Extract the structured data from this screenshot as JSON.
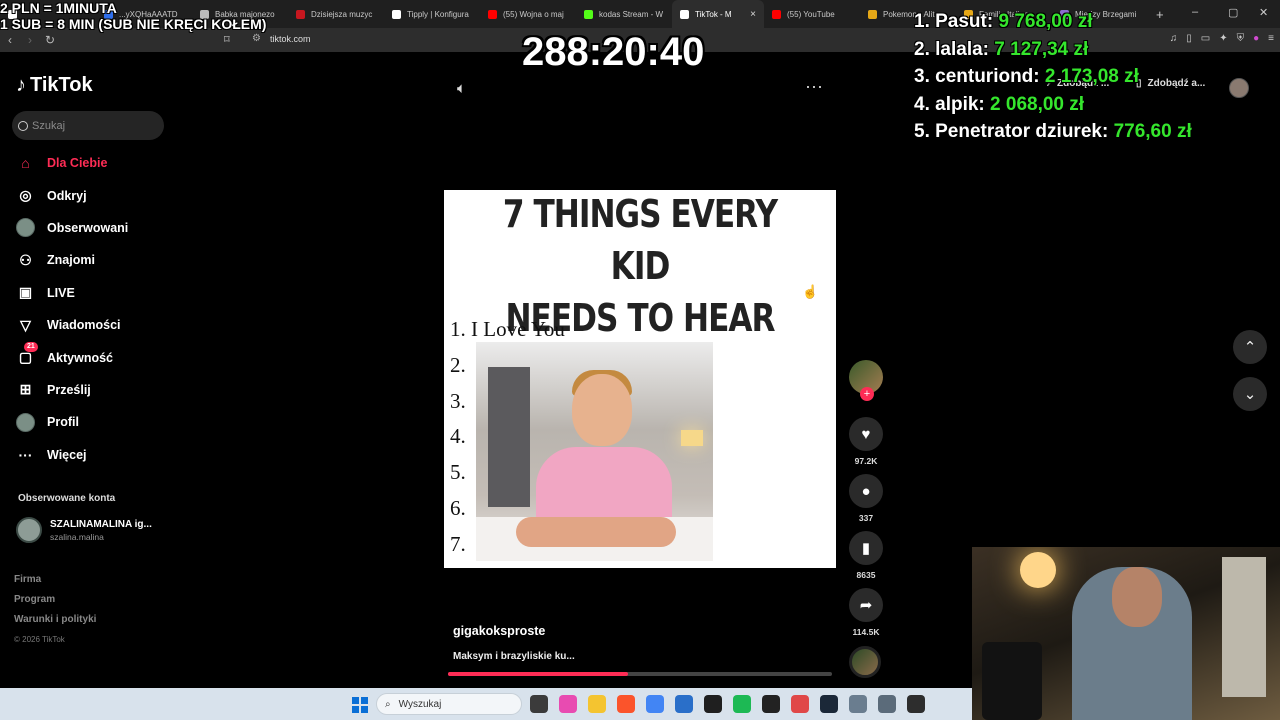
{
  "browser": {
    "tabs": [
      {
        "label": "",
        "color": "#ffffff"
      },
      {
        "label": "...yXQHaAAATD",
        "color": "#2f6fed"
      },
      {
        "label": "Babka majonezo",
        "color": "#bbbbbb"
      },
      {
        "label": "Dzisiejsza muzyc",
        "color": "#c6171f"
      },
      {
        "label": "Tipply | Konfigura",
        "color": "#ffffff"
      },
      {
        "label": "(55) Wojna o maj",
        "color": "#ff0000"
      },
      {
        "label": "kodas Stream - W",
        "color": "#53fc18"
      },
      {
        "label": "TikTok - M",
        "color": "#ffffff",
        "active": true
      },
      {
        "label": "(55) YouTube",
        "color": "#ff0000"
      },
      {
        "label": "Pokemon - Alit",
        "color": "#e6a817"
      },
      {
        "label": "Familia Italiano",
        "color": "#e6a817"
      },
      {
        "label": "Miedzy Brzegami",
        "color": "#8a6dd0"
      }
    ],
    "url": "tiktok.com"
  },
  "overlay": {
    "rule_line1": "2 PLN = 1MINUTA",
    "rule_line2": "1 SUB = 8 MIN (SUB NIE KRĘCI KOŁEM)",
    "timer": "288:20:40",
    "leaderboard": [
      {
        "rank": "1.",
        "name": "Pasut:",
        "amount": "9 768,00 zł"
      },
      {
        "rank": "2.",
        "name": "lalala:",
        "amount": "7 127,34 zł"
      },
      {
        "rank": "3.",
        "name": "centuriond:",
        "amount": "2 173,08 zł"
      },
      {
        "rank": "4.",
        "name": "alpik:",
        "amount": "2 068,00 zł"
      },
      {
        "rank": "5.",
        "name": "Penetrator dziurek:",
        "amount": "776,60 zł"
      }
    ]
  },
  "tiktok": {
    "logo": "TikTok",
    "search_placeholder": "Szukaj",
    "nav": [
      {
        "label": "Dla Ciebie",
        "icon": "home-icon",
        "active": true
      },
      {
        "label": "Odkryj",
        "icon": "compass-icon"
      },
      {
        "label": "Obserwowani",
        "icon": "avatar-icon"
      },
      {
        "label": "Znajomi",
        "icon": "friends-icon"
      },
      {
        "label": "LIVE",
        "icon": "live-icon"
      },
      {
        "label": "Wiadomości",
        "icon": "messages-icon"
      },
      {
        "label": "Aktywność",
        "icon": "activity-icon",
        "badge": "21"
      },
      {
        "label": "Prześlij",
        "icon": "upload-icon"
      },
      {
        "label": "Profil",
        "icon": "profile-icon"
      },
      {
        "label": "Więcej",
        "icon": "more-icon"
      }
    ],
    "followed_title": "Obserwowane konta",
    "followed_account": {
      "name": "SZALINAMALINA ig...",
      "handle": "szalina.malina"
    },
    "footer": {
      "company": "Firma",
      "program": "Program",
      "terms": "Warunki i polityki",
      "copyright": "© 2026 TikTok"
    },
    "pills": {
      "get_coins": "Zdobądź ...",
      "get_app": "Zdobądź a..."
    },
    "video": {
      "title_line1": "7 THINGS EVERY KID",
      "title_line2": "NEEDS TO HEAR",
      "list": [
        "1. I Love You",
        "2.",
        "3.",
        "4.",
        "5.",
        "6.",
        "7."
      ],
      "author": "gigakoksproste",
      "description": "Maksym i brazyliskie ku...",
      "progress": 0.47
    },
    "actions": {
      "likes": "97.2K",
      "comments": "337",
      "saves": "8635",
      "shares": "114.5K"
    }
  },
  "taskbar": {
    "search_placeholder": "Wyszukaj",
    "icons": [
      "#3b3b3b",
      "#e84bb1",
      "#f4c430",
      "#fb542b",
      "#4285f4",
      "#2a6fc9",
      "#1f1f1f",
      "#1db954",
      "#222222",
      "#e04848",
      "#1b2838",
      "#6a7d8f",
      "#5b6b7a",
      "#2d2d2d"
    ]
  }
}
